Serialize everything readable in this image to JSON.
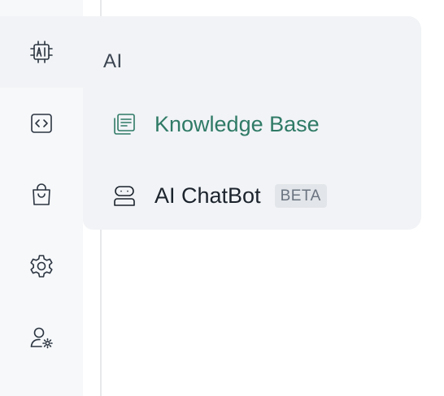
{
  "sidebar": {
    "items": [
      {
        "icon": "ai-chip-icon",
        "active": true
      },
      {
        "icon": "code-icon",
        "active": false
      },
      {
        "icon": "shopping-bag-icon",
        "active": false
      },
      {
        "icon": "gear-icon",
        "active": false
      },
      {
        "icon": "user-settings-icon",
        "active": false
      }
    ]
  },
  "flyout": {
    "title": "AI",
    "items": [
      {
        "label": "Knowledge Base",
        "icon": "knowledge-base-icon",
        "color": "#2f7a66"
      },
      {
        "label": "AI ChatBot",
        "icon": "chatbot-icon",
        "badge": "BETA"
      }
    ]
  }
}
